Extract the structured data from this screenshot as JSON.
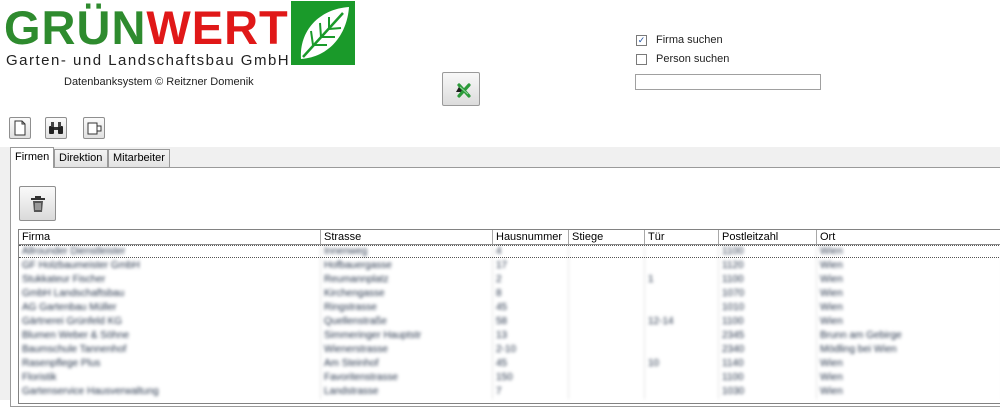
{
  "header": {
    "logo_part1": "GRÜN",
    "logo_part2": "WERT",
    "logo_subtitle": "Garten- und Landschaftsbau GmbH",
    "copyright": "Datenbanksystem © Reitzner Domenik",
    "logo_icon": "leaf-icon",
    "brand_green": "#2e8b2e",
    "brand_red": "#e01818"
  },
  "search": {
    "firma_label": "Firma suchen",
    "firma_checked": true,
    "person_label": "Person suchen",
    "person_checked": false,
    "query": ""
  },
  "toolbar": {
    "export_icon": "excel-export-icon",
    "new_icon": "new-document-icon",
    "search_icon": "binoculars-icon",
    "exit_icon": "exit-door-icon",
    "delete_icon": "trash-icon"
  },
  "tabs": [
    {
      "label": "Firmen",
      "active": true
    },
    {
      "label": "Direktion",
      "active": false
    },
    {
      "label": "Mitarbeiter",
      "active": false
    }
  ],
  "table": {
    "columns": [
      "Firma",
      "Strasse",
      "Hausnummer",
      "Stiege",
      "Tür",
      "Postleitzahl",
      "Ort"
    ],
    "rows": [
      [
        "Allrounder Dienstleister",
        "Innenweg",
        "4",
        "",
        "",
        "1100",
        "Wien"
      ],
      [
        "GF Holzbaumeister GmbH",
        "Hofbauergasse",
        "17",
        "",
        "",
        "1120",
        "Wien"
      ],
      [
        "Stukkateur Fischer",
        "Reumannplatz",
        "2",
        "",
        "1",
        "1100",
        "Wien"
      ],
      [
        "GmbH Landschaftsbau",
        "Kirchengasse",
        "8",
        "",
        "",
        "1070",
        "Wien"
      ],
      [
        "AG Gartenbau Müller",
        "Ringstrasse",
        "45",
        "",
        "",
        "1010",
        "Wien"
      ],
      [
        "Gärtnerei Grünfeld KG",
        "Quellenstraße",
        "58",
        "",
        "12-14",
        "1100",
        "Wien"
      ],
      [
        "Blumen Weber & Söhne",
        "Simmeringer Hauptstr",
        "13",
        "",
        "",
        "2345",
        "Brunn am Gebirge"
      ],
      [
        "Baumschule Tannenhof",
        "Wienerstrasse",
        "2-10",
        "",
        "",
        "2340",
        "Mödling bei Wien"
      ],
      [
        "Rasenpflege Plus",
        "Am Steinhof",
        "45",
        "",
        "10",
        "1140",
        "Wien"
      ],
      [
        "Floristik",
        "Favoritenstrasse",
        "150",
        "",
        "",
        "1100",
        "Wien"
      ],
      [
        "Gartenservice Hausverwaltung",
        "Landstrasse",
        "7",
        "",
        "",
        "1030",
        "Wien"
      ]
    ]
  }
}
